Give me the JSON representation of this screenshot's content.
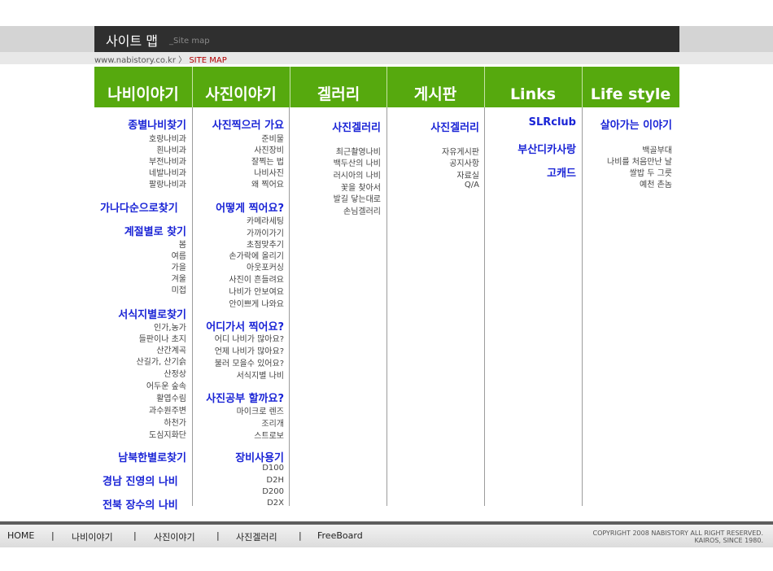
{
  "page": {
    "title": "사이트 맵",
    "title_en": "_Site map"
  },
  "breadcrumb": {
    "home": "www.nabistory.co.kr",
    "sep": "〉",
    "current": "SITE MAP"
  },
  "tabs": [
    "나비이야기",
    "사진이야기",
    "겔러리",
    "게시판",
    "Links",
    "Life style"
  ],
  "col1": {
    "h1": "종별나비찾기",
    "s1": [
      "호랑나비과",
      "흰나비과",
      "부전나비과",
      "네발나비과",
      "팔랑나비과"
    ],
    "h2": "가나다순으로찾기",
    "h3": "계절별로 찾기",
    "s3": [
      "봄",
      "여름",
      "가을",
      "겨울",
      "미접"
    ],
    "h4": "서식지별로찾기",
    "s4": [
      "인가,농가",
      "들판이나 초지",
      "산간계곡",
      "산길가, 산기슭",
      "산정상",
      "어두운 숲속",
      "활엽수림",
      "과수원주변",
      "하천가",
      "도심지화단"
    ],
    "h5": "남북한별로찾기",
    "h6": "경남 진영의 나비",
    "h7": "전북 장수의 나비"
  },
  "col2": {
    "h1": "사진찍으러 가요",
    "s1": [
      "준비물",
      "사진장비",
      "잘찍는 법",
      "나비사진",
      "왜 찍어요"
    ],
    "h2": "어떻게 찍어요?",
    "s2": [
      "카메라세팅",
      "가까이가기",
      "초점맞추기",
      "손가락에 올리기",
      "아웃포커싱",
      "사진이 흔들려요",
      "나비가 안보여요",
      "안이쁘게 나와요"
    ],
    "h3": "어디가서 찍어요?",
    "s3": [
      "어디 나비가 많아요?",
      "언제 나비가 많아요?",
      "불러 모을수 있어요?",
      "서식지별 나비"
    ],
    "h4": "사진공부 할까요?",
    "s4": [
      "마이크로 렌즈",
      "조리개",
      "스트로보"
    ],
    "h5": "장비사용기",
    "s5": [
      "D100",
      "D2H",
      "D200",
      "D2X"
    ]
  },
  "col3": {
    "h1": "사진겔러리",
    "s1": [
      "최근촬영나비",
      "백두산의 나비",
      "러시아의 나비",
      "꽃을 찾아서",
      "발길 닿는대로",
      "손님겔러리"
    ]
  },
  "col4": {
    "h1": "사진겔러리",
    "s1": [
      "자유게시판",
      "공지사항",
      "자료실",
      "Q/A"
    ]
  },
  "col5": {
    "h1": "SLRclub",
    "h2": "부산디카사랑",
    "h3": "고캐드"
  },
  "col6": {
    "h1": "살아가는 이야기",
    "s1": [
      "백골부대",
      "나비를 처음만난 날",
      "쌀밥 두 그릇",
      "예천 촌놈"
    ]
  },
  "footer": {
    "nav": [
      "HOME",
      "나비이야기",
      "사진이야기",
      "사진겔러리",
      "FreeBoard"
    ],
    "sep": "|",
    "copyright1": "COPYRIGHT 2008 NABISTORY ALL RIGHT RESERVED.",
    "copyright2": "KAIROS, SINCE 1980."
  },
  "colors": {
    "tab_green": "#56a90e",
    "heading_blue": "#1a24d6",
    "titlebar": "#2f2f2f"
  }
}
